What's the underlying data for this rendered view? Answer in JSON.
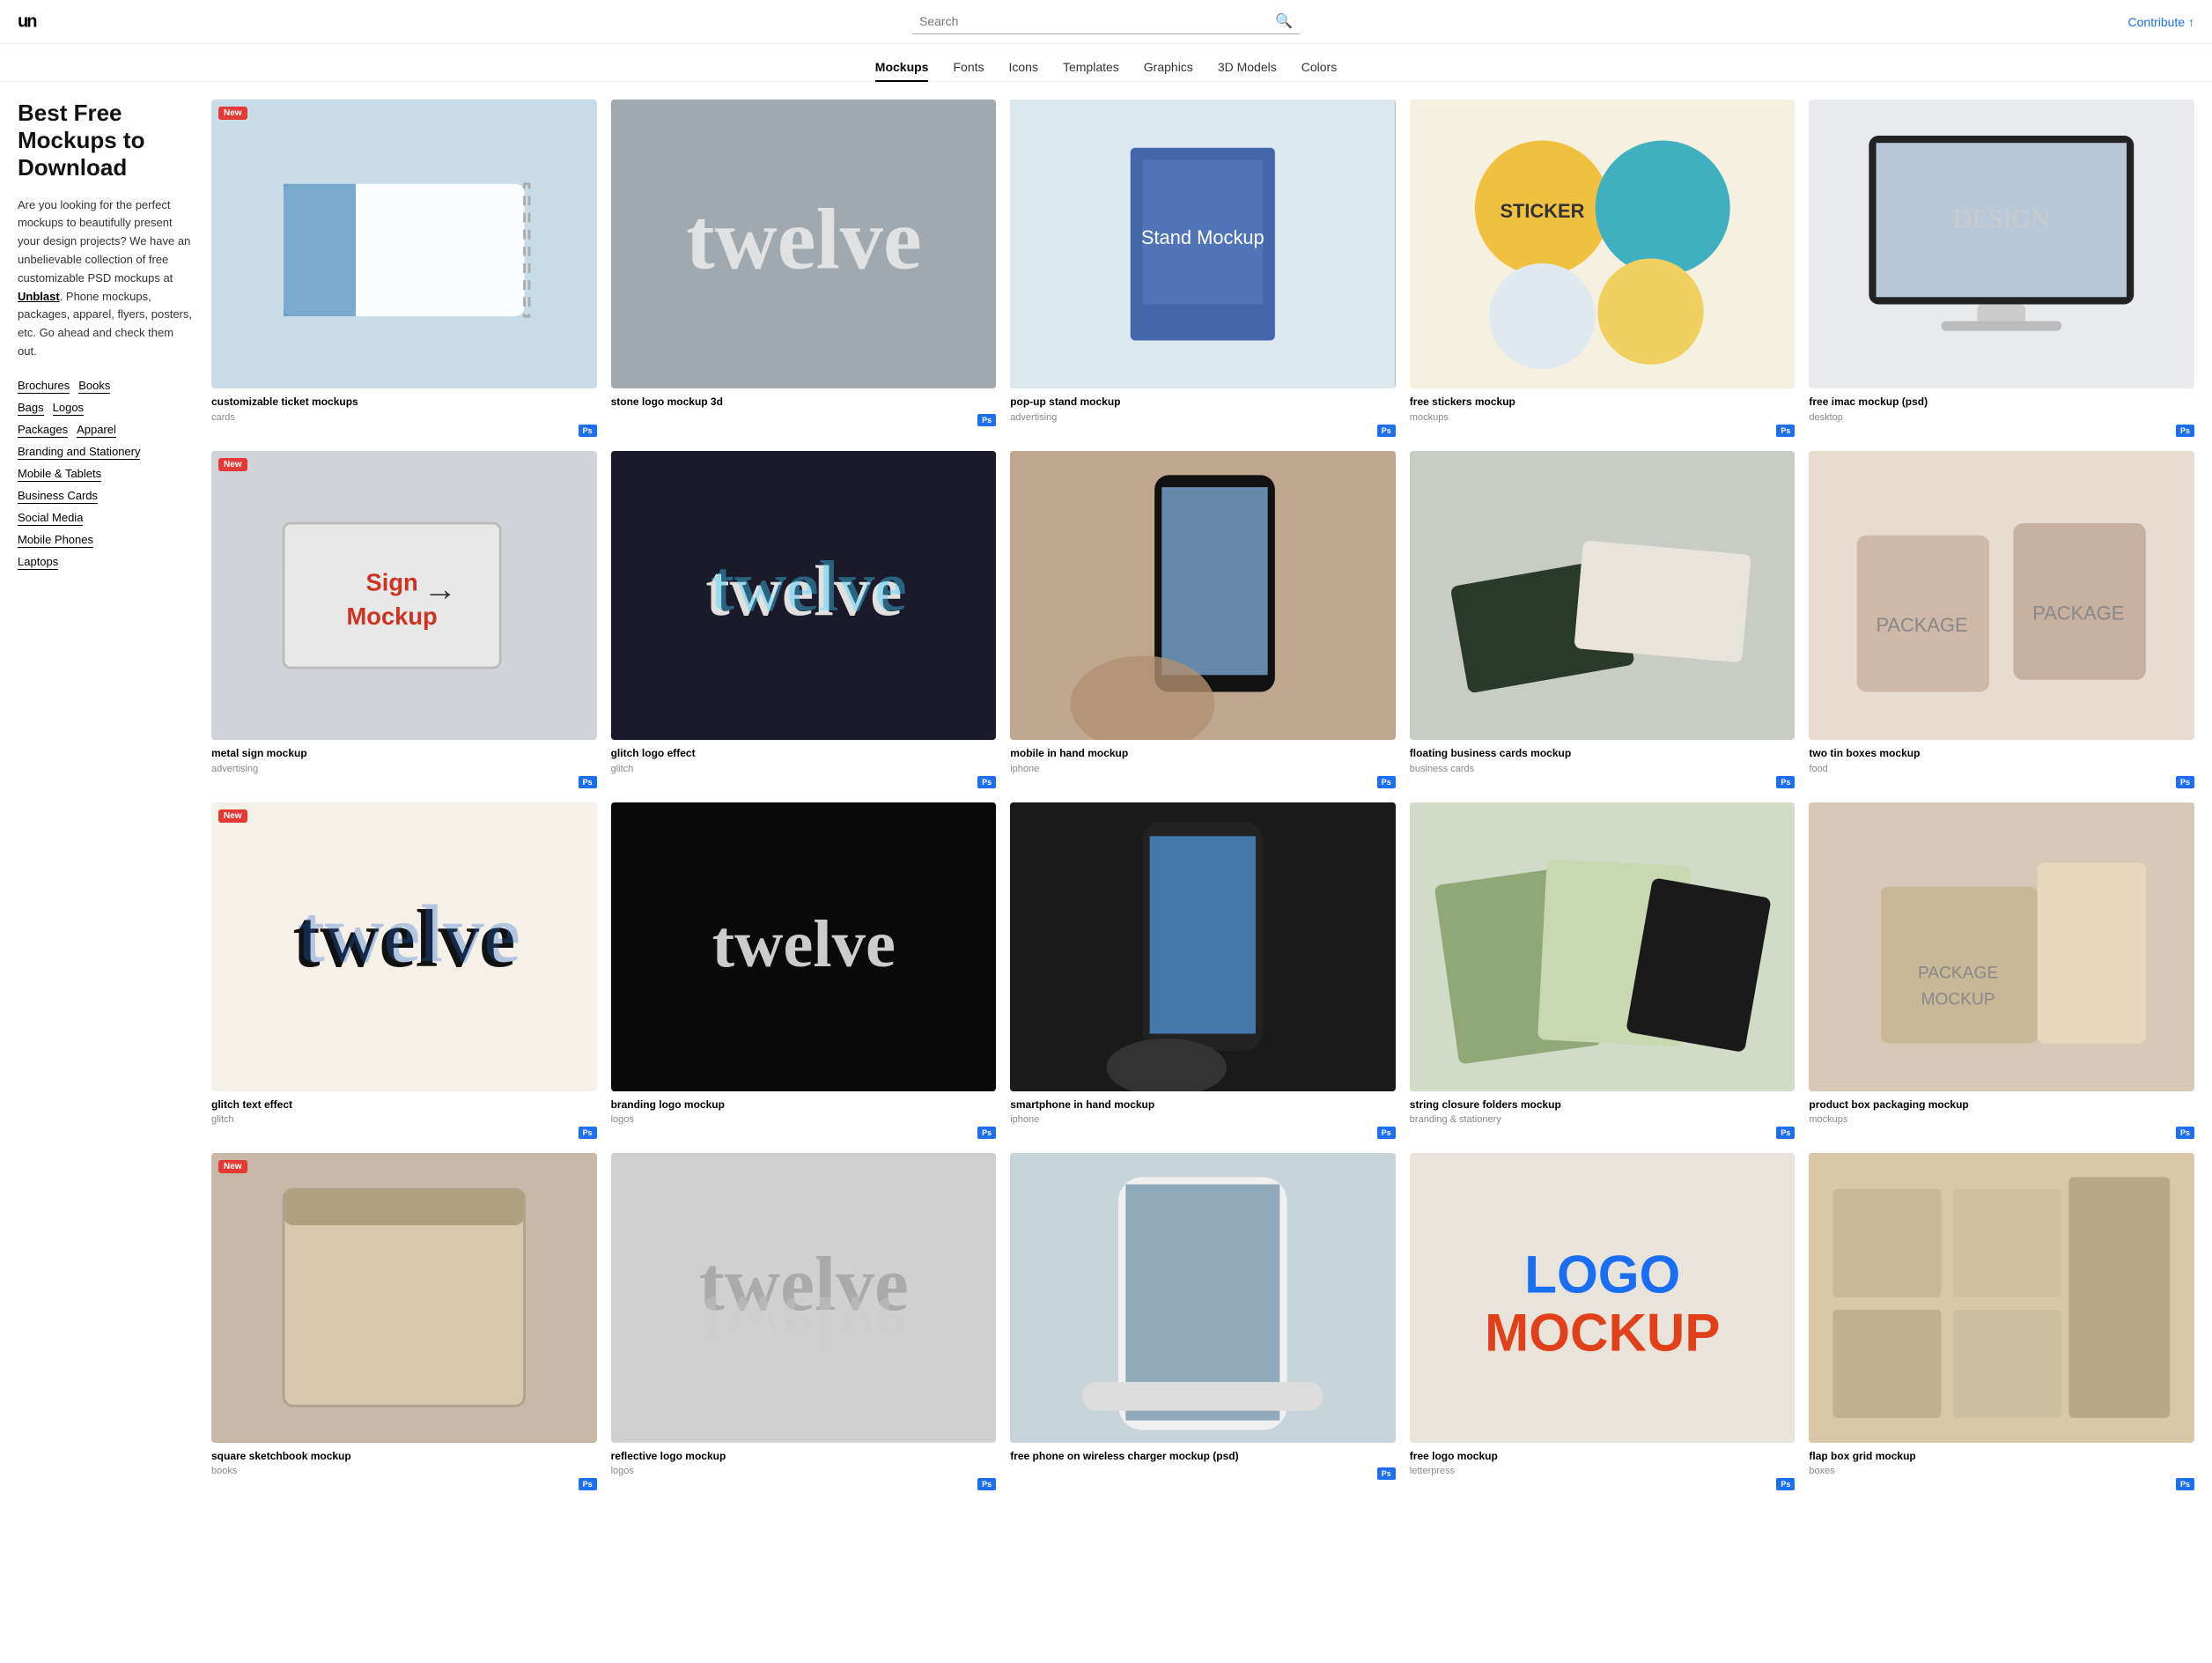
{
  "logo": {
    "text": "un"
  },
  "header": {
    "search_placeholder": "Search",
    "contribute_label": "Contribute ↑"
  },
  "nav": {
    "items": [
      {
        "label": "Mockups",
        "active": true
      },
      {
        "label": "Fonts",
        "active": false
      },
      {
        "label": "Icons",
        "active": false
      },
      {
        "label": "Templates",
        "active": false
      },
      {
        "label": "Graphics",
        "active": false
      },
      {
        "label": "3D Models",
        "active": false
      },
      {
        "label": "Colors",
        "active": false
      }
    ]
  },
  "sidebar": {
    "title": "Best Free Mockups to Download",
    "description": "Are you looking for the perfect mockups to beautifully present your design projects? We have an unbelievable collection of free customizable PSD mockups at Unblast. Phone mockups, packages, apparel, flyers, posters, etc. Go ahead and check them out.",
    "link_text": "Unblast",
    "links": [
      [
        {
          "label": "Brochures"
        },
        {
          "label": "Books"
        }
      ],
      [
        {
          "label": "Bags"
        },
        {
          "label": "Logos"
        }
      ],
      [
        {
          "label": "Packages"
        },
        {
          "label": "Apparel"
        }
      ],
      [
        {
          "label": "Branding and Stationery"
        }
      ],
      [
        {
          "label": "Mobile & Tablets"
        }
      ],
      [
        {
          "label": "Business Cards"
        }
      ],
      [
        {
          "label": "Social Media"
        }
      ],
      [
        {
          "label": "Mobile Phones"
        }
      ],
      [
        {
          "label": "Laptops"
        }
      ]
    ]
  },
  "grid": {
    "cards": [
      {
        "title": "customizable ticket mockups",
        "subtitle": "cards",
        "badge": "New",
        "ps": true,
        "bg": "#c8dce8",
        "img_label": "ticket mockup"
      },
      {
        "title": "stone logo mockup 3d",
        "subtitle": "",
        "badge": "",
        "ps": true,
        "bg": "#b0b8c0",
        "img_label": "twelve stone"
      },
      {
        "title": "pop-up stand mockup",
        "subtitle": "advertising",
        "badge": "",
        "ps": true,
        "bg": "#5577aa",
        "img_label": "stand mockup"
      },
      {
        "title": "free stickers mockup",
        "subtitle": "mockups",
        "badge": "",
        "ps": true,
        "bg": "#f5e8c0",
        "img_label": "stickers"
      },
      {
        "title": "free imac mockup (psd)",
        "subtitle": "desktop",
        "badge": "",
        "ps": true,
        "bg": "#e8eaed",
        "img_label": "imac mockup"
      },
      {
        "title": "metal sign mockup",
        "subtitle": "advertising",
        "badge": "New",
        "ps": true,
        "bg": "#d5d8dc",
        "img_label": "sign mockup"
      },
      {
        "title": "glitch logo effect",
        "subtitle": "glitch",
        "badge": "",
        "ps": true,
        "bg": "#2a2a2a",
        "img_label": "twelve glitch"
      },
      {
        "title": "mobile in hand mockup",
        "subtitle": "iphone",
        "badge": "",
        "ps": true,
        "bg": "#b8977a",
        "img_label": "mobile hand"
      },
      {
        "title": "floating business cards mockup",
        "subtitle": "business cards",
        "badge": "",
        "ps": true,
        "bg": "#c8ccc8",
        "img_label": "biz cards"
      },
      {
        "title": "two tin boxes mockup",
        "subtitle": "food",
        "badge": "",
        "ps": true,
        "bg": "#e8dcd0",
        "img_label": "tin boxes"
      },
      {
        "title": "glitch text effect",
        "subtitle": "glitch",
        "badge": "New",
        "ps": true,
        "bg": "#f5f0e8",
        "img_label": "twelve text"
      },
      {
        "title": "branding logo mockup",
        "subtitle": "logos",
        "badge": "",
        "ps": true,
        "bg": "#101010",
        "img_label": "twelve dark"
      },
      {
        "title": "smartphone in hand mockup",
        "subtitle": "iphone",
        "badge": "",
        "ps": true,
        "bg": "#1a1a1a",
        "img_label": "smartphone"
      },
      {
        "title": "string closure folders mockup",
        "subtitle": "branding & stationery",
        "badge": "",
        "ps": true,
        "bg": "#b0c8a8",
        "img_label": "folders"
      },
      {
        "title": "product box packaging mockup",
        "subtitle": "mockups",
        "badge": "",
        "ps": true,
        "bg": "#d8c8b8",
        "img_label": "box packaging"
      },
      {
        "title": "square sketchbook mockup",
        "subtitle": "books",
        "badge": "New",
        "ps": true,
        "bg": "#c8b098",
        "img_label": "sketchbook"
      },
      {
        "title": "reflective logo mockup",
        "subtitle": "logos",
        "badge": "",
        "ps": true,
        "bg": "#d8d8d8",
        "img_label": "twelve reflect"
      },
      {
        "title": "free phone on wireless charger mockup (psd)",
        "subtitle": "",
        "badge": "",
        "ps": true,
        "bg": "#c8d4dc",
        "img_label": "phone charger"
      },
      {
        "title": "free logo mockup",
        "subtitle": "letterpress",
        "badge": "",
        "ps": true,
        "bg": "#e8e4dc",
        "img_label": "LOGO MOCKUP"
      },
      {
        "title": "flap box grid mockup",
        "subtitle": "boxes",
        "badge": "",
        "ps": true,
        "bg": "#d8c8a8",
        "img_label": "flap box"
      }
    ]
  }
}
